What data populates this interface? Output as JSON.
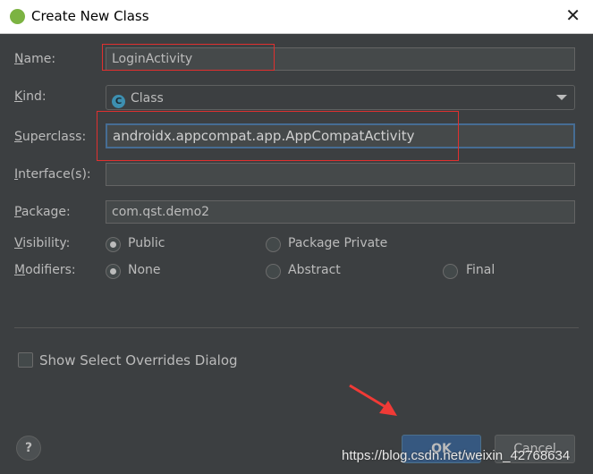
{
  "window": {
    "title": "Create New Class",
    "close": "✕"
  },
  "form": {
    "name": {
      "label": "Name:",
      "mnemonic": "N",
      "rest": "ame:",
      "value": "LoginActivity"
    },
    "kind": {
      "label": "Kind:",
      "mnemonic": "K",
      "rest": "ind:",
      "value": "Class",
      "icon_letter": "C"
    },
    "superclass": {
      "label": "Superclass:",
      "mnemonic": "S",
      "rest": "uperclass:",
      "value": "androidx.appcompat.app.AppCompatActivity"
    },
    "interfaces": {
      "label": "Interface(s):",
      "mnemonic": "I",
      "rest": "nterface(s):",
      "value": ""
    },
    "package": {
      "label": "Package:",
      "mnemonic": "P",
      "rest": "ackage:",
      "value": "com.qst.demo2"
    },
    "visibility": {
      "label": "Visibility:",
      "mnemonic": "V",
      "rest": "isibility:",
      "options": [
        "Public",
        "Package Private"
      ],
      "selected": "Public"
    },
    "modifiers": {
      "label": "Modifiers:",
      "mnemonic": "M",
      "rest": "odifiers:",
      "options": [
        "None",
        "Abstract",
        "Final"
      ],
      "selected": "None"
    },
    "show_overrides": {
      "label": "Show Select Overrides Dialog",
      "checked": false
    }
  },
  "buttons": {
    "help": "?",
    "ok": "OK",
    "cancel": "Cancel"
  },
  "watermark": "https://blog.csdn.net/weixin_42768634",
  "colors": {
    "accent": "#365880",
    "annotation": "#e0302f",
    "background": "#3c3f41"
  }
}
